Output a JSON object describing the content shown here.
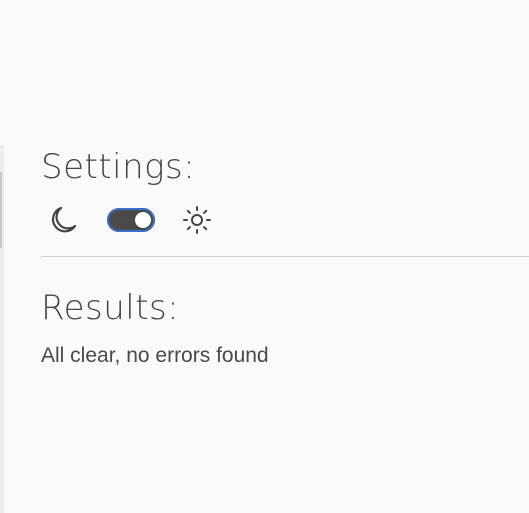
{
  "settings": {
    "heading": "Settings:",
    "theme_toggle": {
      "left_icon": "moon-icon",
      "right_icon": "sun-icon",
      "state": "dark-selected"
    }
  },
  "results": {
    "heading": "Results:",
    "message": "All clear, no errors found"
  },
  "colors": {
    "background": "#fafafa",
    "text": "#454545",
    "toggle_track": "#4a4a4a",
    "toggle_focus_ring": "#3b6fc9",
    "divider": "#d2d2d2"
  }
}
